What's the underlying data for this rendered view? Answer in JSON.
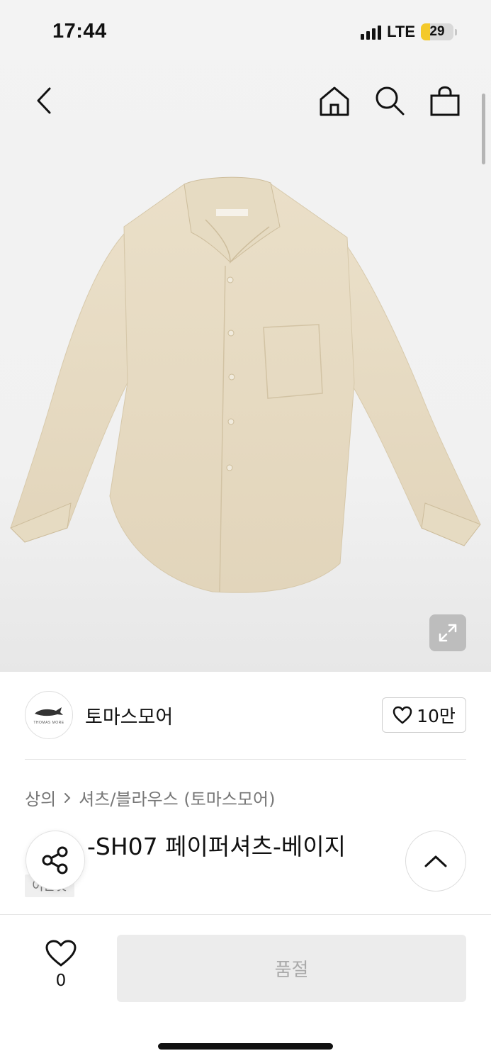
{
  "status_bar": {
    "time": "17:44",
    "network": "LTE",
    "battery": "29",
    "battery_level": 0.29
  },
  "nav": {
    "icons": [
      "back-icon",
      "home-icon",
      "search-icon",
      "shopping-bag-icon"
    ]
  },
  "product_image": {
    "alt": "Beige paper shirt",
    "shirt_color": "#e8dcc4",
    "expand_icon": "expand-icon"
  },
  "brand": {
    "name": "토마스모어",
    "logo_text": "THOMAS MORE",
    "likes": "10만"
  },
  "category": {
    "primary": "상의",
    "secondary": "셔츠/블라우스 (토마스모어)"
  },
  "product": {
    "title": "T…-SH07 페이퍼셔츠-베이지",
    "title_visible": "-SH07 페이퍼셔츠-베이지",
    "tag": "이는것"
  },
  "bottom": {
    "wish_count": "0",
    "buy_label": "품절"
  },
  "colors": {
    "accent_battery": "#f4c92a",
    "disabled_button": "#ececec",
    "text_muted": "#777777"
  }
}
